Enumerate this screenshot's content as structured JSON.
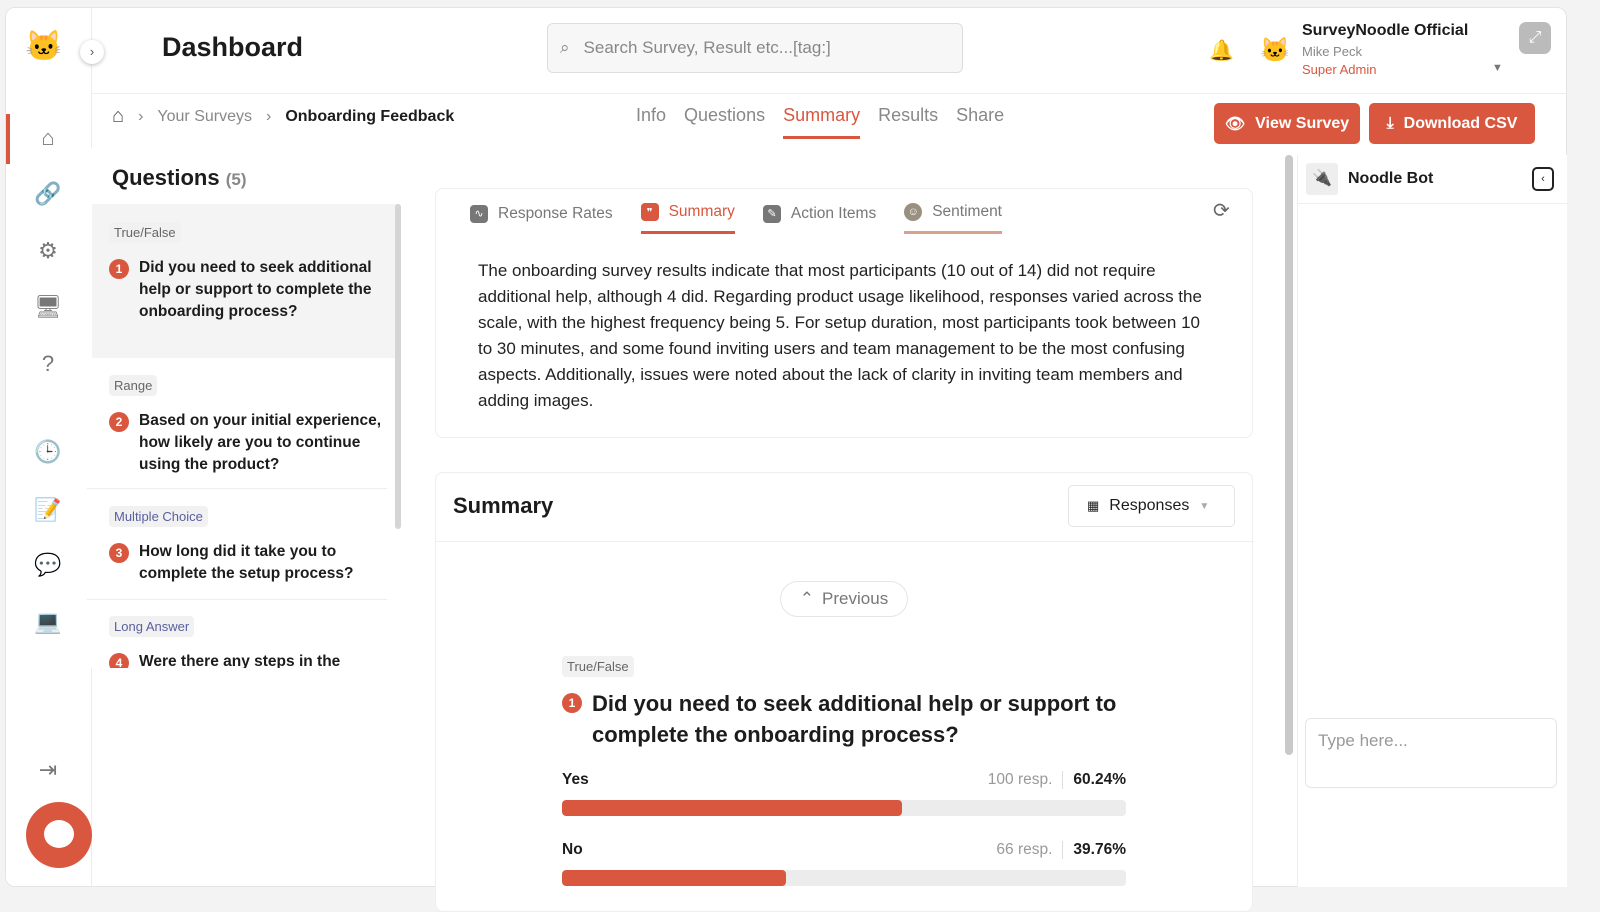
{
  "header": {
    "title": "Dashboard",
    "search_placeholder": "Search Survey, Result etc...[tag:]",
    "org": "SurveyNoodle Official",
    "user": "Mike Peck",
    "role": "Super Admin"
  },
  "breadcrumb": [
    "Your Surveys",
    "Onboarding Feedback"
  ],
  "tabs": [
    "Info",
    "Questions",
    "Summary",
    "Results",
    "Share"
  ],
  "active_tab": "Summary",
  "actions": {
    "view": "View Survey",
    "download": "Download CSV"
  },
  "questions": {
    "title": "Questions",
    "count": "(5)",
    "items": [
      {
        "type": "True/False",
        "num": "1",
        "text": "Did you need to seek additional help or support to complete the onboarding process?"
      },
      {
        "type": "Range",
        "num": "2",
        "text": "Based on your initial experience, how likely are you to continue using the product?"
      },
      {
        "type": "Multiple Choice",
        "num": "3",
        "text": "How long did it take you to complete the setup process?"
      },
      {
        "type": "Long Answer",
        "num": "4",
        "text": "Were there any steps in the"
      }
    ]
  },
  "summary_tabs": [
    "Response Rates",
    "Summary",
    "Action Items",
    "Sentiment"
  ],
  "summary_text": "The onboarding survey results indicate that most participants (10 out of 14) did not require additional help, although 4 did. Regarding product usage likelihood, responses varied across the scale, with the highest frequency being 5. For setup duration, most participants took between 10 to 30 minutes, and some found inviting users and team management to be the most confusing aspects. Additionally, issues were noted about the lack of clarity in inviting team members and adding images.",
  "summary_card": {
    "title": "Summary",
    "dropdown": "Responses",
    "previous": "Previous",
    "q_type": "True/False",
    "q_num": "1",
    "q_text": "Did you need to seek additional help or support to complete the onboarding process?",
    "options": [
      {
        "label": "Yes",
        "resp": "100 resp.",
        "pct": "60.24%",
        "value": 60.24
      },
      {
        "label": "No",
        "resp": "66 resp.",
        "pct": "39.76%",
        "value": 39.76
      }
    ]
  },
  "bot": {
    "name": "Noodle Bot",
    "placeholder": "Type here..."
  },
  "colors": {
    "accent": "#d9573f"
  }
}
